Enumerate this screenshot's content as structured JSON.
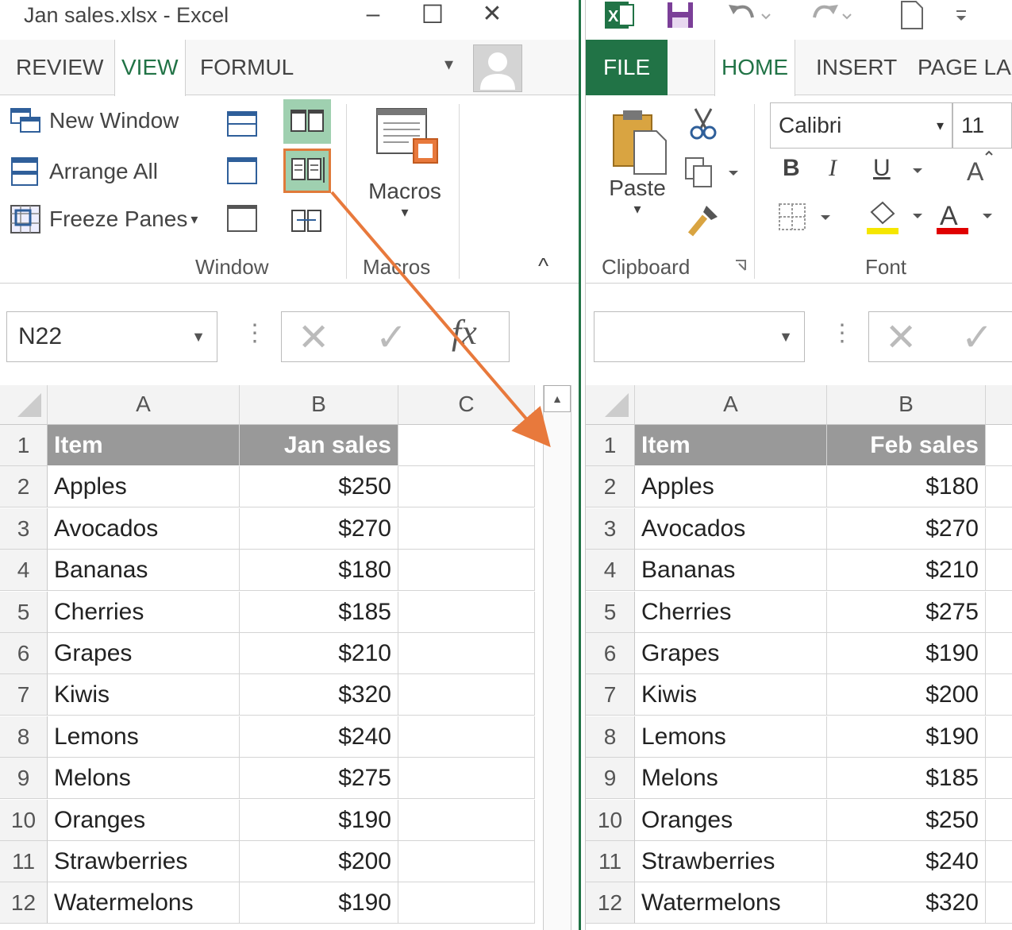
{
  "left": {
    "title": "Jan sales.xlsx - Excel",
    "window_buttons": {
      "minimize": "–",
      "restore": "☐",
      "close": "✕"
    },
    "tabs": [
      "REVIEW",
      "VIEW",
      "FORMUL"
    ],
    "active_tab": "VIEW",
    "tab_dropdown": "▾",
    "ribbon": {
      "window_group": {
        "new_window": "New Window",
        "arrange_all": "Arrange All",
        "freeze_panes": "Freeze Panes",
        "freeze_caret": "▾",
        "label": "Window"
      },
      "macros_group": {
        "macros": "Macros",
        "macros_caret": "▾",
        "label": "Macros"
      },
      "collapse": "^"
    },
    "name_box": "N22",
    "name_box_caret": "▼",
    "formula_dots": "⋮",
    "formula_cancel": "✕",
    "formula_enter": "✓",
    "formula_fx": "fx",
    "columns": [
      "A",
      "B",
      "C"
    ],
    "rows": [
      "1",
      "2",
      "3",
      "4",
      "5",
      "6",
      "7",
      "8",
      "9",
      "10",
      "11",
      "12"
    ],
    "header": {
      "item": "Item",
      "sales": "Jan sales"
    },
    "data": [
      {
        "item": "Apples",
        "value": "$250"
      },
      {
        "item": "Avocados",
        "value": "$270"
      },
      {
        "item": "Bananas",
        "value": "$180"
      },
      {
        "item": "Cherries",
        "value": "$185"
      },
      {
        "item": "Grapes",
        "value": "$210"
      },
      {
        "item": "Kiwis",
        "value": "$320"
      },
      {
        "item": "Lemons",
        "value": "$240"
      },
      {
        "item": "Melons",
        "value": "$275"
      },
      {
        "item": "Oranges",
        "value": "$190"
      },
      {
        "item": "Strawberries",
        "value": "$200"
      },
      {
        "item": "Watermelons",
        "value": "$190"
      }
    ],
    "scroll_up": "▲"
  },
  "right": {
    "tabs": [
      "FILE",
      "HOME",
      "INSERT",
      "PAGE LA"
    ],
    "active_tab": "HOME",
    "ribbon": {
      "paste": "Paste",
      "paste_caret": "▾",
      "clipboard_label": "Clipboard",
      "font_name": "Calibri",
      "font_caret": "▾",
      "font_size": "11",
      "bold": "B",
      "italic": "I",
      "underline": "U",
      "font_label": "Font"
    },
    "name_box": "",
    "name_box_caret": "▼",
    "formula_dots": "⋮",
    "formula_cancel": "✕",
    "formula_enter": "✓",
    "columns": [
      "A",
      "B"
    ],
    "rows": [
      "1",
      "2",
      "3",
      "4",
      "5",
      "6",
      "7",
      "8",
      "9",
      "10",
      "11",
      "12"
    ],
    "header": {
      "item": "Item",
      "sales": "Feb sales"
    },
    "data": [
      {
        "item": "Apples",
        "value": "$180"
      },
      {
        "item": "Avocados",
        "value": "$270"
      },
      {
        "item": "Bananas",
        "value": "$210"
      },
      {
        "item": "Cherries",
        "value": "$275"
      },
      {
        "item": "Grapes",
        "value": "$190"
      },
      {
        "item": "Kiwis",
        "value": "$200"
      },
      {
        "item": "Lemons",
        "value": "$190"
      },
      {
        "item": "Melons",
        "value": "$185"
      },
      {
        "item": "Oranges",
        "value": "$250"
      },
      {
        "item": "Strawberries",
        "value": "$240"
      },
      {
        "item": "Watermelons",
        "value": "$320"
      }
    ]
  },
  "colors": {
    "excel_green": "#217346",
    "header_fill": "#999999",
    "highlight_box": "#e07a3a",
    "arrow": "#e8793c",
    "active_button_bg": "#9fd0b0"
  }
}
